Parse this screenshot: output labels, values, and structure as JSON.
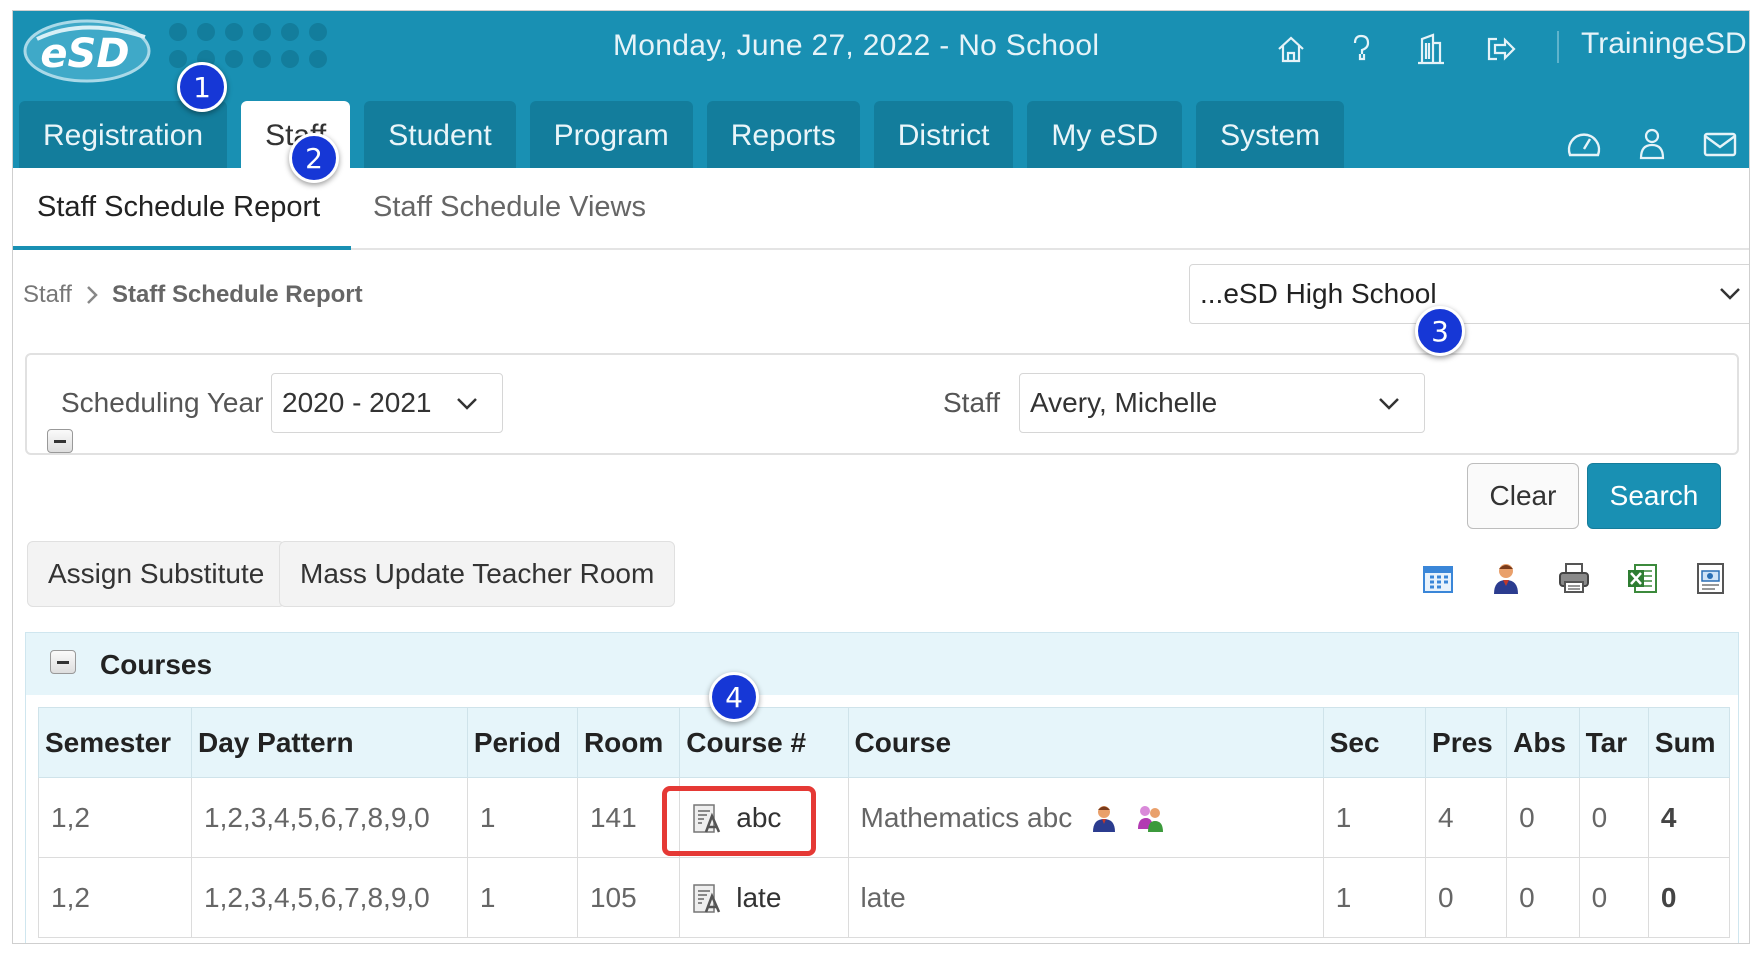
{
  "app": {
    "logo_text": "eSD"
  },
  "header": {
    "date_status": "Monday, June 27, 2022 - No School",
    "username": "TrainingeSD",
    "icons": [
      "home-icon",
      "help-icon",
      "building-icon",
      "logout-icon"
    ]
  },
  "nav": {
    "tabs": [
      {
        "label": "Registration"
      },
      {
        "label": "Staff"
      },
      {
        "label": "Student"
      },
      {
        "label": "Program"
      },
      {
        "label": "Reports"
      },
      {
        "label": "District"
      },
      {
        "label": "My eSD"
      },
      {
        "label": "System"
      }
    ],
    "active_tab": "Staff",
    "right_icons": [
      "dashboard-icon",
      "users-icon",
      "mail-icon"
    ]
  },
  "subnav": {
    "tabs": [
      {
        "label": "Staff Schedule Report"
      },
      {
        "label": "Staff Schedule Views"
      }
    ]
  },
  "breadcrumb": {
    "parent": "Staff",
    "current": "Staff Schedule Report"
  },
  "school_select": {
    "value": "...eSD High School"
  },
  "filters": {
    "year_label": "Scheduling Year",
    "year_value": "2020 - 2021",
    "staff_label": "Staff",
    "staff_value": "Avery, Michelle"
  },
  "buttons": {
    "clear": "Clear",
    "search": "Search",
    "assign_substitute": "Assign Substitute",
    "mass_update": "Mass Update Teacher Room"
  },
  "toolbar_icons": [
    "calendar-icon",
    "teacher-icon",
    "print-icon",
    "excel-icon",
    "report-icon"
  ],
  "courses": {
    "title": "Courses",
    "columns": [
      "Semester",
      "Day Pattern",
      "Period",
      "Room",
      "Course #",
      "Course",
      "Sec",
      "Pres",
      "Abs",
      "Tar",
      "Sum"
    ],
    "rows": [
      {
        "semester": "1,2",
        "day_pattern": "1,2,3,4,5,6,7,8,9,0",
        "period": "1",
        "room": "141",
        "course_num": "abc",
        "course": "Mathematics abc",
        "sec": "1",
        "pres": "4",
        "abs": "0",
        "tar": "0",
        "sum": "4"
      },
      {
        "semester": "1,2",
        "day_pattern": "1,2,3,4,5,6,7,8,9,0",
        "period": "1",
        "room": "105",
        "course_num": "late",
        "course": "late",
        "sec": "1",
        "pres": "0",
        "abs": "0",
        "tar": "0",
        "sum": "0"
      }
    ]
  },
  "annotations": {
    "badges": [
      "1",
      "2",
      "3",
      "4"
    ],
    "badge_color": "#1637d6",
    "highlight_color": "#e53935"
  },
  "colors": {
    "brand": "#1990b3",
    "tab_bg": "#137d9c"
  }
}
